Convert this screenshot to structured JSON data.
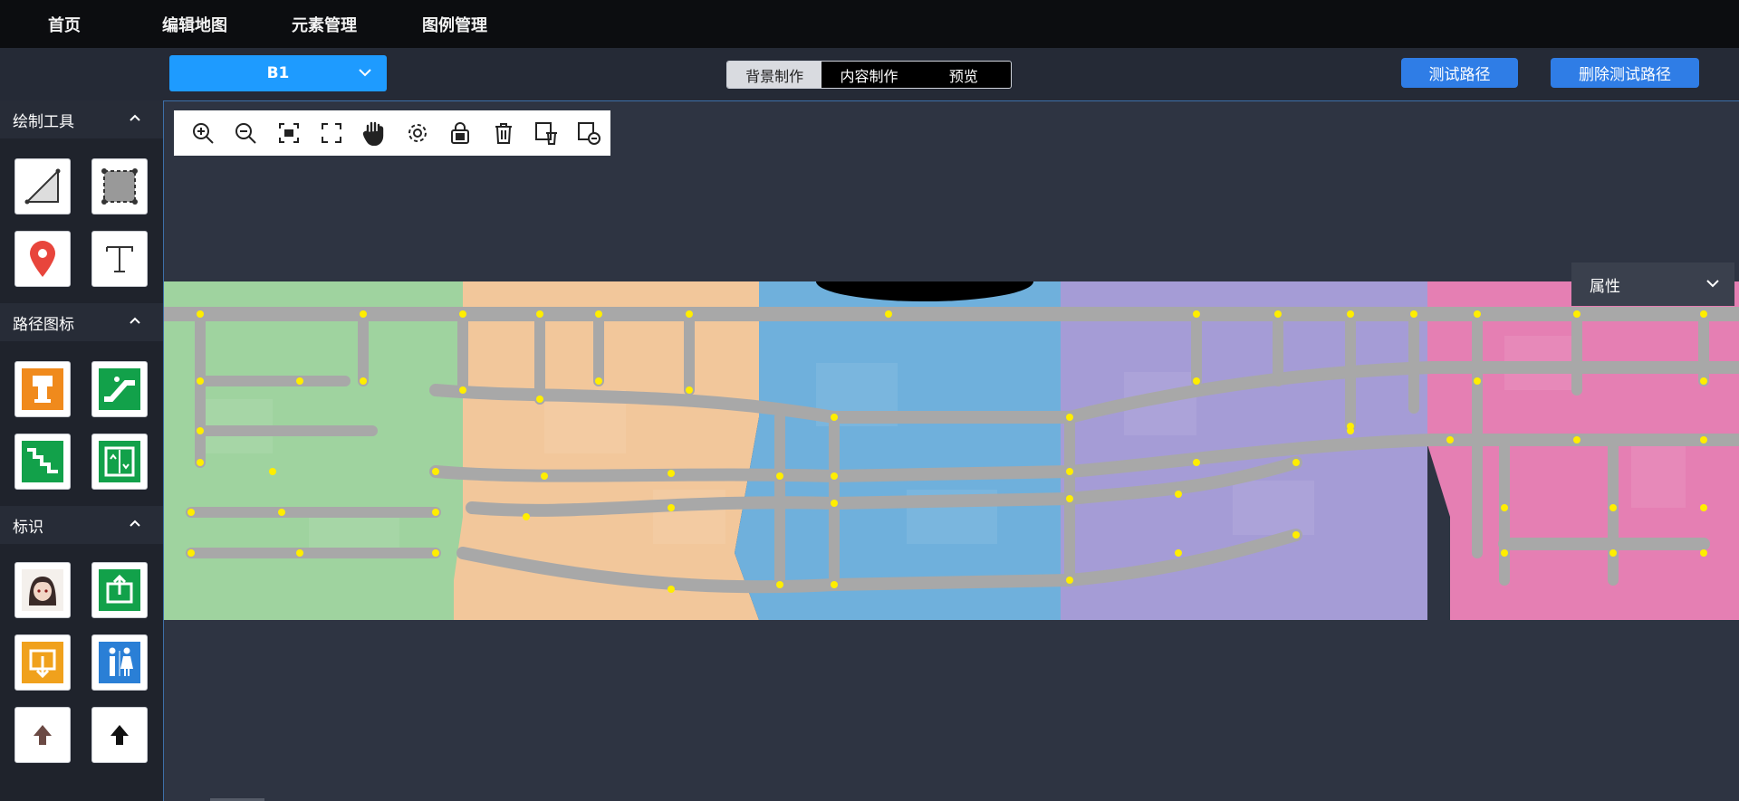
{
  "topnav": {
    "items": [
      "首页",
      "编辑地图",
      "元素管理",
      "图例管理"
    ]
  },
  "floor": {
    "value": "B1"
  },
  "mode_tabs": {
    "items": [
      "背景制作",
      "内容制作",
      "预览"
    ],
    "active": 0
  },
  "actions": {
    "test_route": "测试路径",
    "delete_test_route": "删除测试路径"
  },
  "sidebar": {
    "sections": [
      {
        "title": "绘制工具",
        "tools": [
          "polyline-tool-icon",
          "rectangle-tool-icon",
          "map-pin-icon",
          "text-tool-icon"
        ]
      },
      {
        "title": "路径图标",
        "tools": [
          "ticket-machine-icon",
          "escalator-icon",
          "stairs-icon",
          "elevator-icon"
        ]
      },
      {
        "title": "标识",
        "tools": [
          "avatar-image",
          "exit-icon",
          "entrance-icon",
          "restroom-icon",
          "arrow-up-dark-icon",
          "arrow-up-icon"
        ]
      }
    ]
  },
  "toolbar": {
    "tools": [
      "zoom-in-icon",
      "zoom-out-icon",
      "fit-view-icon",
      "fullscreen-icon",
      "pan-hand-icon",
      "settings-icon",
      "lock-icon",
      "delete-icon",
      "delete-layer-icon",
      "remove-layer-icon"
    ]
  },
  "properties": {
    "label": "属性"
  },
  "colors": {
    "zone_green": "#9fd39f",
    "zone_orange": "#f2c79b",
    "zone_blue": "#6fb0dc",
    "zone_purple": "#a59cd6",
    "zone_pink": "#e57fb3",
    "road": "#a8a8a8",
    "node": "#ffee00",
    "accent": "#1e9bff"
  }
}
